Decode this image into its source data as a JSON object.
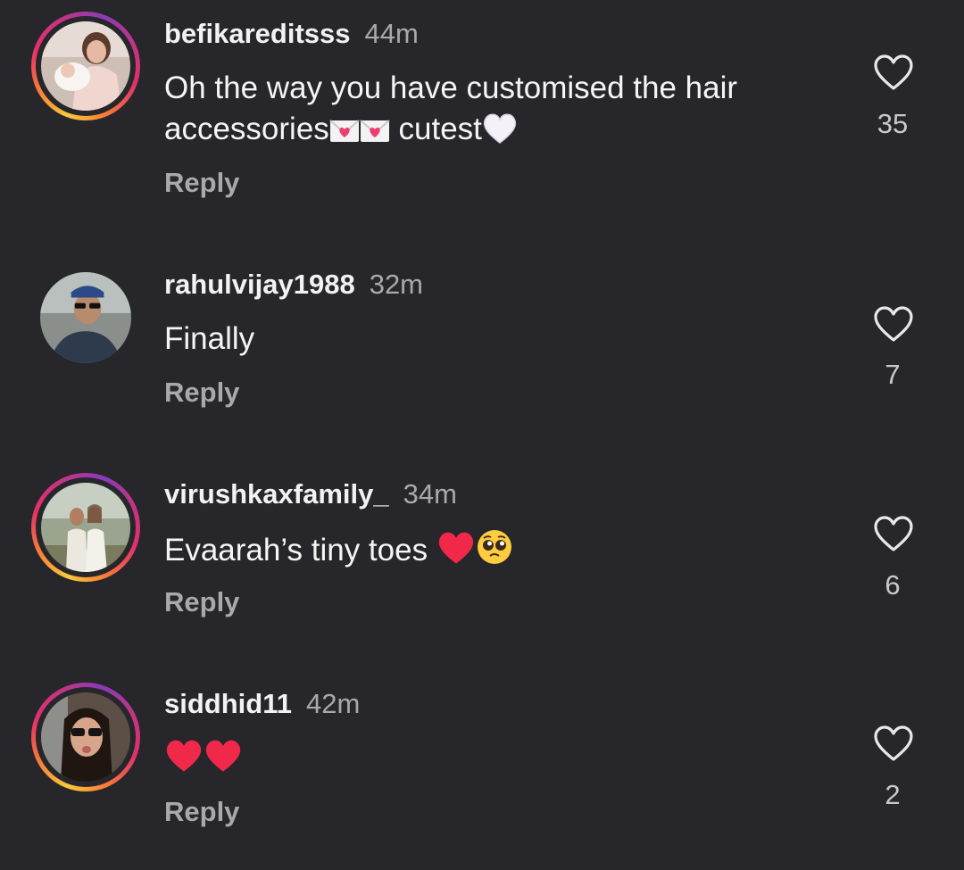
{
  "comments": [
    {
      "username": "befikareditsss",
      "time": "44m",
      "text_line1": "Oh the way you have customised the hair",
      "text_line2_a": "accessories",
      "text_line2_b": " cutest",
      "emojis": [
        "love-letter",
        "love-letter",
        "white-heart"
      ],
      "reply_label": "Reply",
      "likes": "35",
      "avatar_ring": true
    },
    {
      "username": "rahulvijay1988",
      "time": "32m",
      "text": "Finally",
      "reply_label": "Reply",
      "likes": "7",
      "avatar_ring": false
    },
    {
      "username": "virushkaxfamily_",
      "time": "34m",
      "text": "Evaarah’s tiny toes ",
      "emojis": [
        "red-heart",
        "pleading-face"
      ],
      "reply_label": "Reply",
      "likes": "6",
      "avatar_ring": true
    },
    {
      "username": "siddhid11",
      "time": "42m",
      "text": "",
      "emojis": [
        "red-heart",
        "red-heart"
      ],
      "reply_label": "Reply",
      "likes": "2",
      "avatar_ring": true
    }
  ],
  "colors": {
    "background": "#26262b",
    "secondary_text": "#a8a8ad",
    "heart_emoji": "#f0284a"
  }
}
